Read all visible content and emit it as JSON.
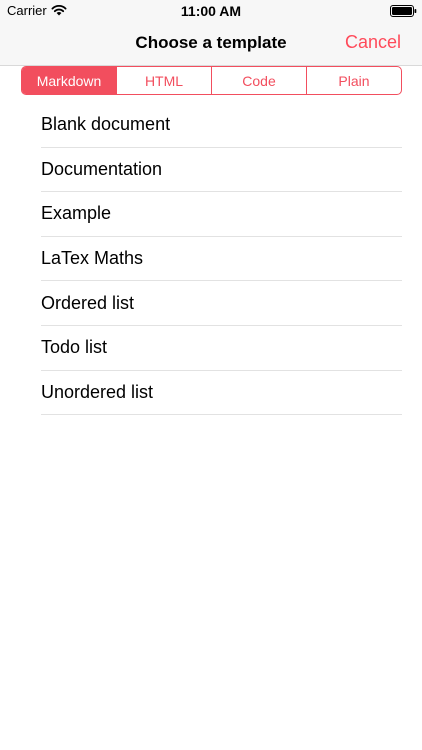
{
  "status_bar": {
    "carrier": "Carrier",
    "time": "11:00 AM",
    "icons": [
      "wifi-icon",
      "battery-icon"
    ]
  },
  "nav": {
    "title": "Choose a template",
    "cancel_label": "Cancel"
  },
  "segments": [
    {
      "label": "Markdown",
      "selected": true
    },
    {
      "label": "HTML",
      "selected": false
    },
    {
      "label": "Code",
      "selected": false
    },
    {
      "label": "Plain",
      "selected": false
    }
  ],
  "templates": [
    "Blank document",
    "Documentation",
    "Example",
    "LaTex Maths",
    "Ordered list",
    "Todo list",
    "Unordered list"
  ],
  "colors": {
    "accent": "#f24e5e",
    "cancel": "#ff4a5a",
    "bar_background": "#f7f7f7",
    "separator": "#e2e2e2"
  }
}
